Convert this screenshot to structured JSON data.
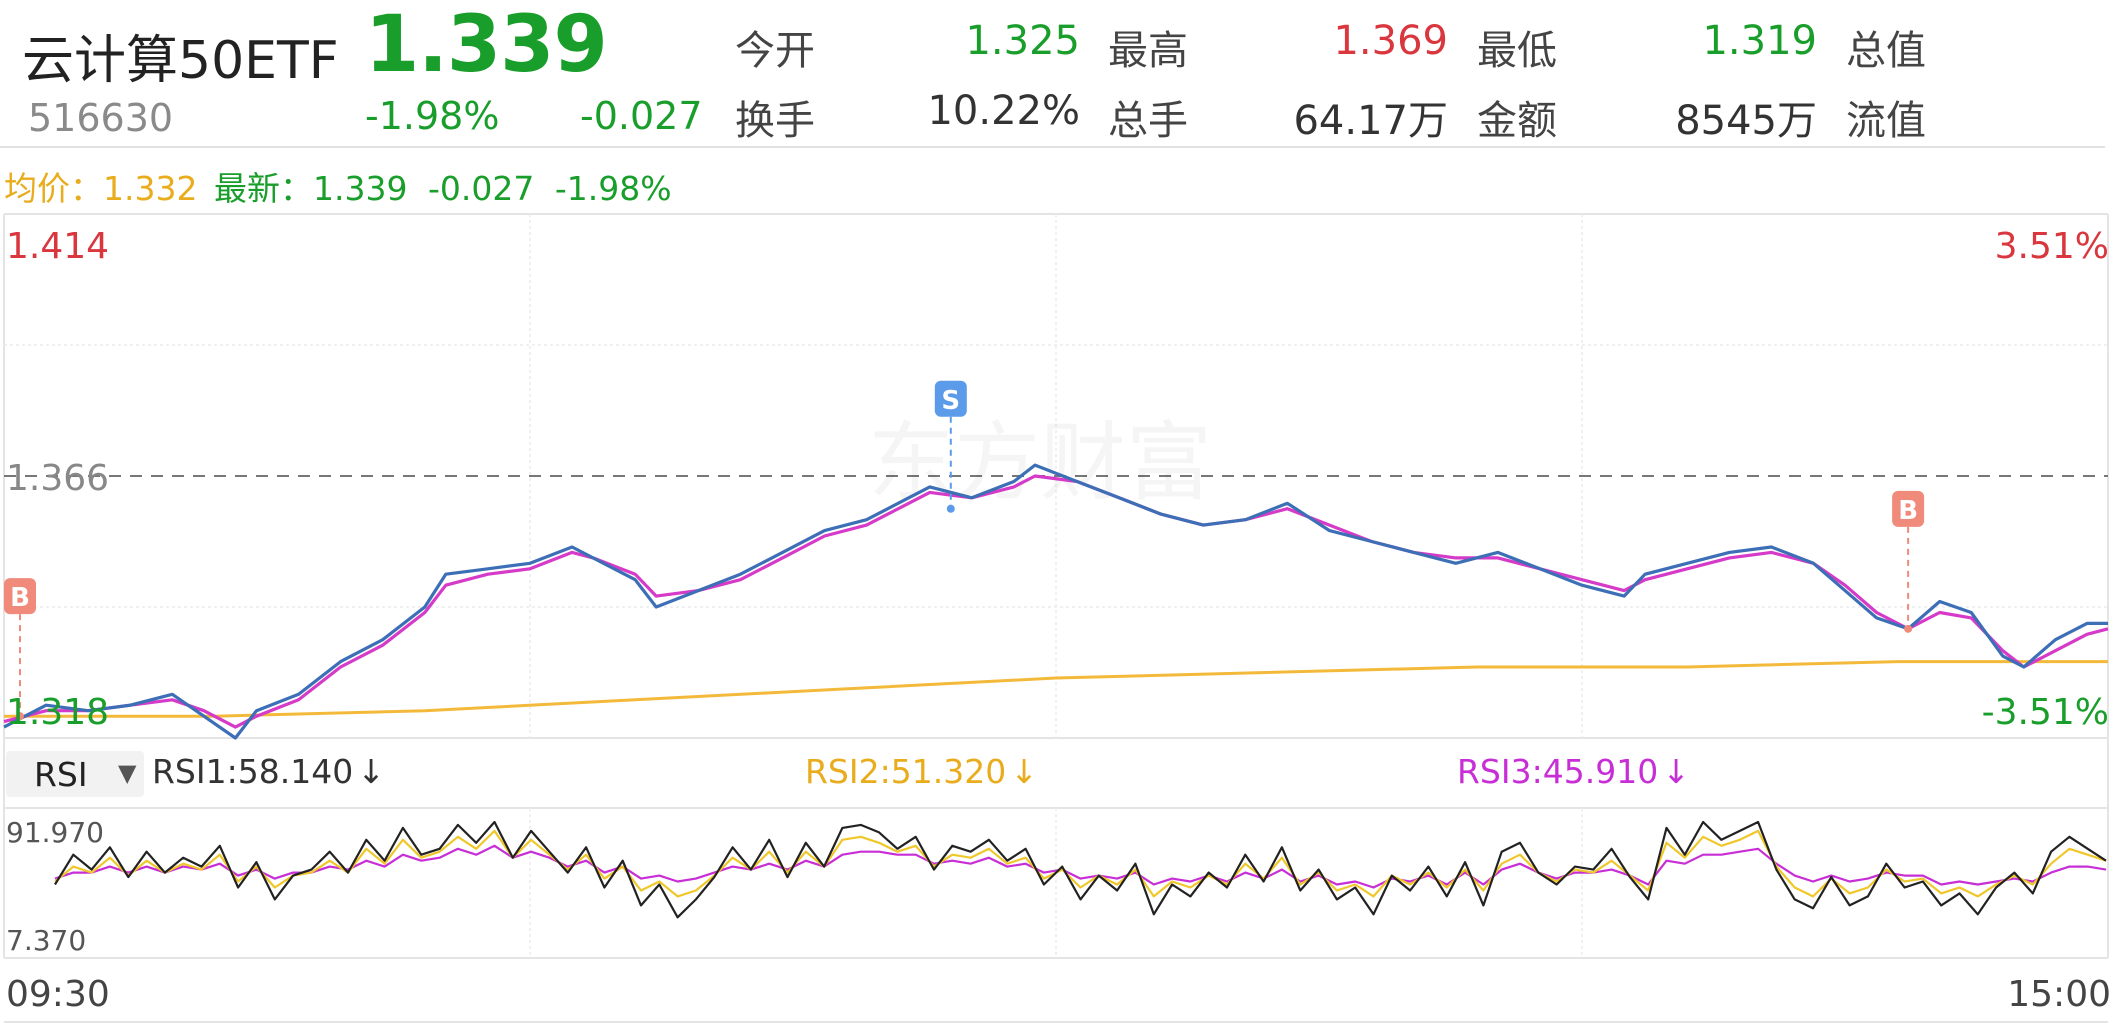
{
  "header": {
    "name": "云计算50ETF",
    "price": "1.339",
    "code": "516630",
    "change_pct": "-1.98%",
    "change": "-0.027",
    "stats": [
      {
        "label": "今开",
        "value": "1.325",
        "color": "#1a9e2b"
      },
      {
        "label": "最高",
        "value": "1.369",
        "color": "#d9363e"
      },
      {
        "label": "最低",
        "value": "1.319",
        "color": "#1a9e2b"
      },
      {
        "label": "总值",
        "value": "",
        "color": "#333333"
      },
      {
        "label": "换手",
        "value": "10.22%",
        "color": "#333333"
      },
      {
        "label": "总手",
        "value": "64.17万",
        "color": "#333333"
      },
      {
        "label": "金额",
        "value": "8545万",
        "color": "#333333"
      },
      {
        "label": "流值",
        "value": "",
        "color": "#333333"
      }
    ]
  },
  "legend": {
    "avg_label": "均价：",
    "avg_value": "1.332",
    "latest_label": "最新：",
    "latest_value": "1.339",
    "latest_change": "-0.027",
    "latest_pct": "-1.98%"
  },
  "rsi_selector": {
    "label": "RSI",
    "arrow": "▼"
  },
  "rsi_legend": {
    "rsi1": "RSI1:58.140",
    "rsi2": "RSI2:51.320",
    "rsi3": "RSI3:45.910",
    "arrow": "↓"
  },
  "colors": {
    "price_line": "#3d6fb6",
    "avg_line": "#f3b93a",
    "ma_line": "#d63ac8",
    "rsi1": "#222222",
    "rsi2": "#f0c72a",
    "rsi3": "#c82ed6",
    "up": "#d9363e",
    "down": "#1a9e2b",
    "buy_marker": "#f08a7a",
    "sell_marker": "#5b9bea"
  },
  "watermark": "东方财富",
  "chart_data": [
    {
      "type": "line",
      "ylim": [
        1.318,
        1.414
      ],
      "y_ticks": [
        "1.414",
        "1.366",
        "1.318"
      ],
      "pct_ticks": [
        "3.51%",
        "-3.51%"
      ],
      "ref_price": 1.366,
      "markers": [
        {
          "label": "B",
          "t": 0.0,
          "price": 1.322
        },
        {
          "label": "S",
          "t": 0.45,
          "price": 1.36
        },
        {
          "label": "B",
          "t": 0.905,
          "price": 1.338
        }
      ],
      "series": [
        {
          "role": "price",
          "points": [
            [
              0,
              1.32
            ],
            [
              0.02,
              1.324
            ],
            [
              0.04,
              1.323
            ],
            [
              0.06,
              1.324
            ],
            [
              0.08,
              1.326
            ],
            [
              0.095,
              1.322
            ],
            [
              0.11,
              1.318
            ],
            [
              0.12,
              1.323
            ],
            [
              0.14,
              1.326
            ],
            [
              0.16,
              1.332
            ],
            [
              0.18,
              1.336
            ],
            [
              0.2,
              1.342
            ],
            [
              0.21,
              1.348
            ],
            [
              0.23,
              1.349
            ],
            [
              0.25,
              1.35
            ],
            [
              0.27,
              1.353
            ],
            [
              0.28,
              1.351
            ],
            [
              0.3,
              1.347
            ],
            [
              0.31,
              1.342
            ],
            [
              0.33,
              1.345
            ],
            [
              0.35,
              1.348
            ],
            [
              0.37,
              1.352
            ],
            [
              0.39,
              1.356
            ],
            [
              0.41,
              1.358
            ],
            [
              0.43,
              1.362
            ],
            [
              0.44,
              1.364
            ],
            [
              0.46,
              1.362
            ],
            [
              0.48,
              1.365
            ],
            [
              0.49,
              1.368
            ],
            [
              0.51,
              1.365
            ],
            [
              0.53,
              1.362
            ],
            [
              0.55,
              1.359
            ],
            [
              0.57,
              1.357
            ],
            [
              0.59,
              1.358
            ],
            [
              0.61,
              1.361
            ],
            [
              0.63,
              1.356
            ],
            [
              0.65,
              1.354
            ],
            [
              0.67,
              1.352
            ],
            [
              0.69,
              1.35
            ],
            [
              0.71,
              1.352
            ],
            [
              0.73,
              1.349
            ],
            [
              0.75,
              1.346
            ],
            [
              0.77,
              1.344
            ],
            [
              0.78,
              1.348
            ],
            [
              0.8,
              1.35
            ],
            [
              0.82,
              1.352
            ],
            [
              0.84,
              1.353
            ],
            [
              0.86,
              1.35
            ],
            [
              0.875,
              1.345
            ],
            [
              0.89,
              1.34
            ],
            [
              0.905,
              1.338
            ],
            [
              0.92,
              1.343
            ],
            [
              0.935,
              1.341
            ],
            [
              0.95,
              1.333
            ],
            [
              0.96,
              1.331
            ],
            [
              0.975,
              1.336
            ],
            [
              0.99,
              1.339
            ],
            [
              1.0,
              1.339
            ]
          ]
        },
        {
          "role": "ma",
          "points": [
            [
              0,
              1.321
            ],
            [
              0.02,
              1.323
            ],
            [
              0.04,
              1.323
            ],
            [
              0.06,
              1.324
            ],
            [
              0.08,
              1.325
            ],
            [
              0.095,
              1.323
            ],
            [
              0.11,
              1.32
            ],
            [
              0.12,
              1.322
            ],
            [
              0.14,
              1.325
            ],
            [
              0.16,
              1.331
            ],
            [
              0.18,
              1.335
            ],
            [
              0.2,
              1.341
            ],
            [
              0.21,
              1.346
            ],
            [
              0.23,
              1.348
            ],
            [
              0.25,
              1.349
            ],
            [
              0.27,
              1.352
            ],
            [
              0.28,
              1.351
            ],
            [
              0.3,
              1.348
            ],
            [
              0.31,
              1.344
            ],
            [
              0.33,
              1.345
            ],
            [
              0.35,
              1.347
            ],
            [
              0.37,
              1.351
            ],
            [
              0.39,
              1.355
            ],
            [
              0.41,
              1.357
            ],
            [
              0.43,
              1.361
            ],
            [
              0.44,
              1.363
            ],
            [
              0.46,
              1.362
            ],
            [
              0.48,
              1.364
            ],
            [
              0.49,
              1.366
            ],
            [
              0.51,
              1.365
            ],
            [
              0.53,
              1.362
            ],
            [
              0.55,
              1.359
            ],
            [
              0.57,
              1.357
            ],
            [
              0.59,
              1.358
            ],
            [
              0.61,
              1.36
            ],
            [
              0.63,
              1.357
            ],
            [
              0.65,
              1.354
            ],
            [
              0.67,
              1.352
            ],
            [
              0.69,
              1.351
            ],
            [
              0.71,
              1.351
            ],
            [
              0.73,
              1.349
            ],
            [
              0.75,
              1.347
            ],
            [
              0.77,
              1.345
            ],
            [
              0.78,
              1.347
            ],
            [
              0.8,
              1.349
            ],
            [
              0.82,
              1.351
            ],
            [
              0.84,
              1.352
            ],
            [
              0.86,
              1.35
            ],
            [
              0.875,
              1.346
            ],
            [
              0.89,
              1.341
            ],
            [
              0.905,
              1.338
            ],
            [
              0.92,
              1.341
            ],
            [
              0.935,
              1.34
            ],
            [
              0.95,
              1.334
            ],
            [
              0.96,
              1.331
            ],
            [
              0.975,
              1.334
            ],
            [
              0.99,
              1.337
            ],
            [
              1.0,
              1.338
            ]
          ]
        },
        {
          "role": "avg",
          "points": [
            [
              0,
              1.322
            ],
            [
              0.1,
              1.322
            ],
            [
              0.2,
              1.323
            ],
            [
              0.3,
              1.325
            ],
            [
              0.4,
              1.327
            ],
            [
              0.5,
              1.329
            ],
            [
              0.6,
              1.33
            ],
            [
              0.7,
              1.331
            ],
            [
              0.8,
              1.331
            ],
            [
              0.9,
              1.332
            ],
            [
              1.0,
              1.332
            ]
          ]
        }
      ]
    },
    {
      "type": "line",
      "ylim": [
        7.37,
        91.97
      ],
      "y_ticks": [
        "91.970",
        "7.370"
      ],
      "series": [
        {
          "name": "RSI1",
          "values": [
            50,
            70,
            60,
            75,
            55,
            72,
            58,
            68,
            62,
            76,
            48,
            65,
            40,
            56,
            60,
            72,
            58,
            80,
            66,
            88,
            70,
            74,
            90,
            78,
            92,
            68,
            86,
            72,
            58,
            75,
            48,
            66,
            36,
            50,
            28,
            40,
            55,
            75,
            60,
            80,
            55,
            78,
            62,
            88,
            90,
            85,
            74,
            82,
            60,
            76,
            72,
            80,
            66,
            74,
            50,
            62,
            40,
            56,
            46,
            64,
            30,
            50,
            42,
            58,
            48,
            70,
            52,
            75,
            46,
            60,
            40,
            48,
            30,
            56,
            46,
            62,
            42,
            65,
            36,
            72,
            78,
            58,
            50,
            62,
            60,
            74,
            55,
            40,
            88,
            70,
            92,
            80,
            86,
            94,
            60,
            40,
            34,
            55,
            36,
            42,
            64,
            48,
            52,
            36,
            44,
            30,
            48,
            58,
            44,
            72,
            82,
            74,
            66
          ]
        },
        {
          "name": "RSI2",
          "values": [
            52,
            62,
            58,
            68,
            56,
            66,
            58,
            64,
            60,
            70,
            52,
            62,
            48,
            56,
            58,
            66,
            58,
            74,
            64,
            80,
            68,
            72,
            82,
            74,
            86,
            68,
            80,
            70,
            60,
            70,
            54,
            62,
            46,
            52,
            42,
            46,
            56,
            68,
            60,
            72,
            58,
            72,
            62,
            80,
            82,
            78,
            72,
            76,
            62,
            70,
            68,
            74,
            64,
            68,
            54,
            60,
            48,
            56,
            50,
            60,
            42,
            52,
            48,
            56,
            50,
            64,
            54,
            68,
            50,
            58,
            46,
            50,
            42,
            56,
            50,
            58,
            48,
            60,
            46,
            64,
            70,
            58,
            52,
            60,
            58,
            66,
            56,
            46,
            78,
            68,
            82,
            76,
            80,
            86,
            62,
            48,
            42,
            54,
            44,
            48,
            60,
            52,
            54,
            44,
            48,
            42,
            50,
            56,
            50,
            64,
            74,
            70,
            66
          ]
        },
        {
          "name": "RSI3",
          "values": [
            54,
            58,
            58,
            62,
            58,
            62,
            58,
            62,
            60,
            64,
            56,
            60,
            54,
            58,
            58,
            62,
            60,
            66,
            62,
            70,
            66,
            68,
            74,
            70,
            76,
            68,
            72,
            68,
            62,
            66,
            58,
            62,
            54,
            56,
            52,
            54,
            58,
            62,
            60,
            64,
            60,
            66,
            62,
            70,
            72,
            72,
            70,
            70,
            64,
            66,
            64,
            68,
            62,
            64,
            58,
            60,
            54,
            56,
            54,
            58,
            50,
            54,
            52,
            56,
            52,
            58,
            54,
            60,
            52,
            56,
            50,
            52,
            48,
            54,
            52,
            56,
            50,
            58,
            50,
            60,
            64,
            58,
            54,
            58,
            58,
            60,
            56,
            50,
            66,
            64,
            70,
            70,
            72,
            74,
            64,
            56,
            52,
            56,
            52,
            54,
            58,
            56,
            56,
            50,
            52,
            50,
            52,
            54,
            52,
            58,
            62,
            62,
            60
          ]
        }
      ]
    }
  ],
  "time_labels": {
    "start": "09:30",
    "end": "15:00"
  }
}
